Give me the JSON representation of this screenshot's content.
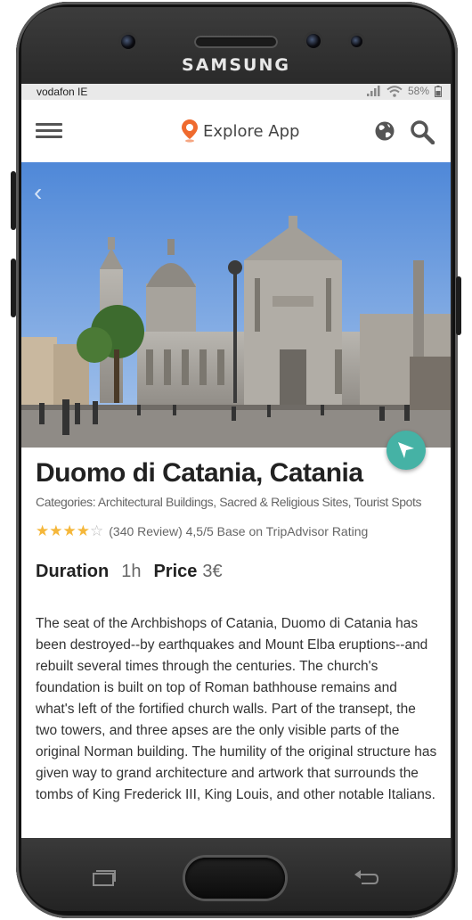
{
  "device": {
    "brand": "SAMSUNG"
  },
  "status_bar": {
    "carrier": "vodafon IE",
    "battery": "58%"
  },
  "app_bar": {
    "title": "Explore App",
    "icons": [
      "menu-icon",
      "map-pin-icon",
      "globe-icon",
      "search-icon"
    ]
  },
  "place": {
    "title": "Duomo di Catania, Catania",
    "categories": "Categories: Architectural Buildings, Sacred & Religious Sites, Tourist Spots",
    "rating_value": 4,
    "rating_max": 5,
    "rating_text": "(340 Review) 4,5/5 Base on TripAdvisor Rating",
    "duration_label": "Duration",
    "duration_value": "1h",
    "price_label": "Price",
    "price_value": "3€",
    "description": "The seat of the Archbishops of Catania, Duomo di Catania has been destroyed--by earthquakes and Mount Elba eruptions--and rebuilt several times through the centuries. The church's foundation is built on top of Roman bathhouse remains and what's left of the fortified church walls. Part of the transept, the two towers, and three apses are the only visible parts of the original Norman building. The humility of the original structure has given way to grand architecture and artwork that surrounds the tombs of King Frederick III, King Louis, and other notable Italians."
  },
  "colors": {
    "accent": "#45b2a5",
    "pin": "#ef6a2e",
    "star": "#f5b73a"
  }
}
